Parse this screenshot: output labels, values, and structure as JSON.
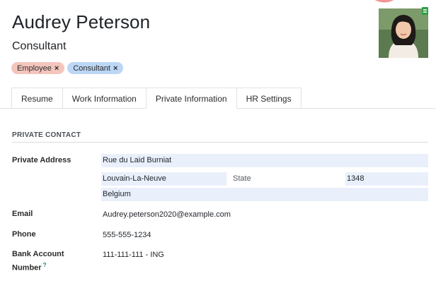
{
  "employee": {
    "name": "Audrey Peterson",
    "job_title": "Consultant",
    "tags": [
      {
        "label": "Employee",
        "color": "#f4c5bd"
      },
      {
        "label": "Consultant",
        "color": "#bcd6f5"
      }
    ],
    "tag_remove_symbol": "×"
  },
  "tabs": [
    {
      "label": "Resume",
      "active": false
    },
    {
      "label": "Work Information",
      "active": false
    },
    {
      "label": "Private Information",
      "active": true
    },
    {
      "label": "HR Settings",
      "active": false
    }
  ],
  "private_contact": {
    "section_title": "PRIVATE CONTACT",
    "address_label": "Private Address",
    "street": "Rue du Laid Burniat",
    "city": "Louvain-La-Neuve",
    "state_placeholder": "State",
    "zip": "1348",
    "country": "Belgium",
    "email_label": "Email",
    "email": "Audrey.peterson2020@example.com",
    "phone_label": "Phone",
    "phone": "555-555-1234",
    "bank_label_line1": "Bank Account",
    "bank_label_line2": "Number",
    "bank_help": "?",
    "bank": "111-111-111 - ING"
  },
  "colors": {
    "accent_help": "#017e84",
    "field_bg": "#e9f0fb",
    "status_green": "#2f9e44"
  }
}
